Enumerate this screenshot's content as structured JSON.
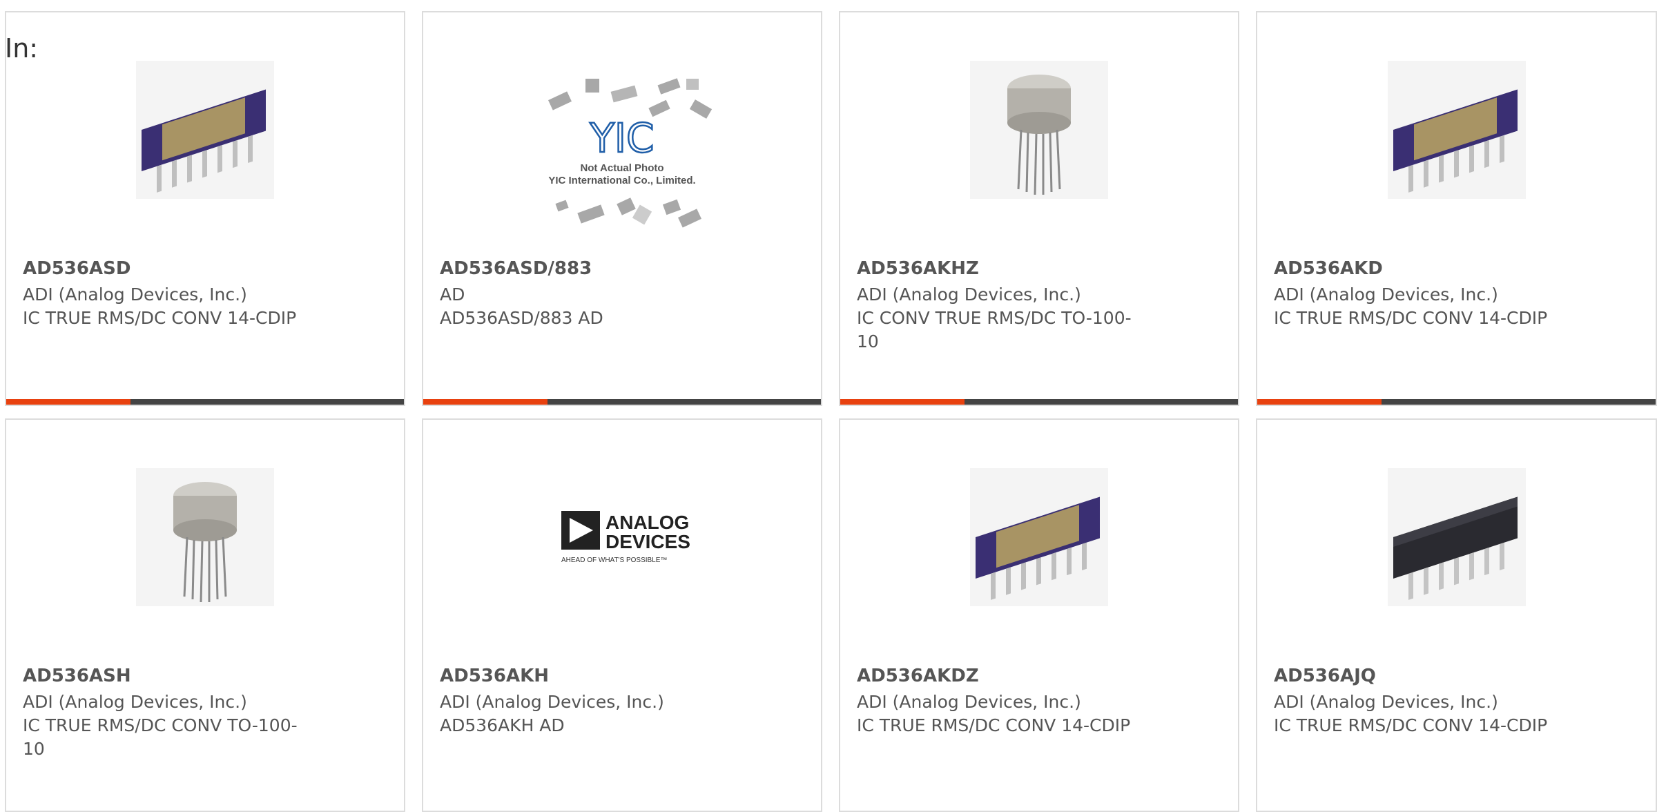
{
  "header": {
    "in_label": "In:"
  },
  "cards": [
    {
      "part": "AD536ASD",
      "manufacturer": "ADI (Analog Devices, Inc.)",
      "description": "IC TRUE RMS/DC CONV 14-CDIP",
      "image": "dip-cerdip-ceramic-gold"
    },
    {
      "part": "AD536ASD/883",
      "manufacturer": "AD",
      "description": "AD536ASD/883 AD",
      "image": "yic-placeholder",
      "image_text": [
        "Not Actual Photo",
        "YIC International Co., Limited."
      ],
      "logo_text": "YIC"
    },
    {
      "part": "AD536AKHZ",
      "manufacturer": "ADI (Analog Devices, Inc.)",
      "description": "IC CONV TRUE RMS/DC TO-100-10",
      "image": "to100-metal-can"
    },
    {
      "part": "AD536AKD",
      "manufacturer": "ADI (Analog Devices, Inc.)",
      "description": "IC TRUE RMS/DC CONV 14-CDIP",
      "image": "dip-cerdip-ceramic-gold"
    },
    {
      "part": "AD536ASH",
      "manufacturer": "ADI (Analog Devices, Inc.)",
      "description": "IC TRUE RMS/DC CONV TO-100-10",
      "image": "to100-metal-can"
    },
    {
      "part": "AD536AKH",
      "manufacturer": "ADI (Analog Devices, Inc.)",
      "description": "AD536AKH AD",
      "image": "analog-devices-logo",
      "logo_lines": [
        "ANALOG",
        "DEVICES"
      ],
      "logo_tagline": "AHEAD OF WHAT'S POSSIBLE™"
    },
    {
      "part": "AD536AKDZ",
      "manufacturer": "ADI (Analog Devices, Inc.)",
      "description": "IC TRUE RMS/DC CONV 14-CDIP",
      "image": "dip-cerdip-ceramic-gold"
    },
    {
      "part": "AD536AJQ",
      "manufacturer": "ADI (Analog Devices, Inc.)",
      "description": "IC TRUE RMS/DC CONV 14-CDIP",
      "image": "dip-cerdip-black"
    }
  ],
  "colors": {
    "accent": "#e8410f",
    "bar": "#444444",
    "border": "#dcdcdc",
    "text": "#555555",
    "chip_body": "#3a2f73",
    "chip_lid": "#a89464",
    "yic_blue": "#1f5ea8"
  }
}
